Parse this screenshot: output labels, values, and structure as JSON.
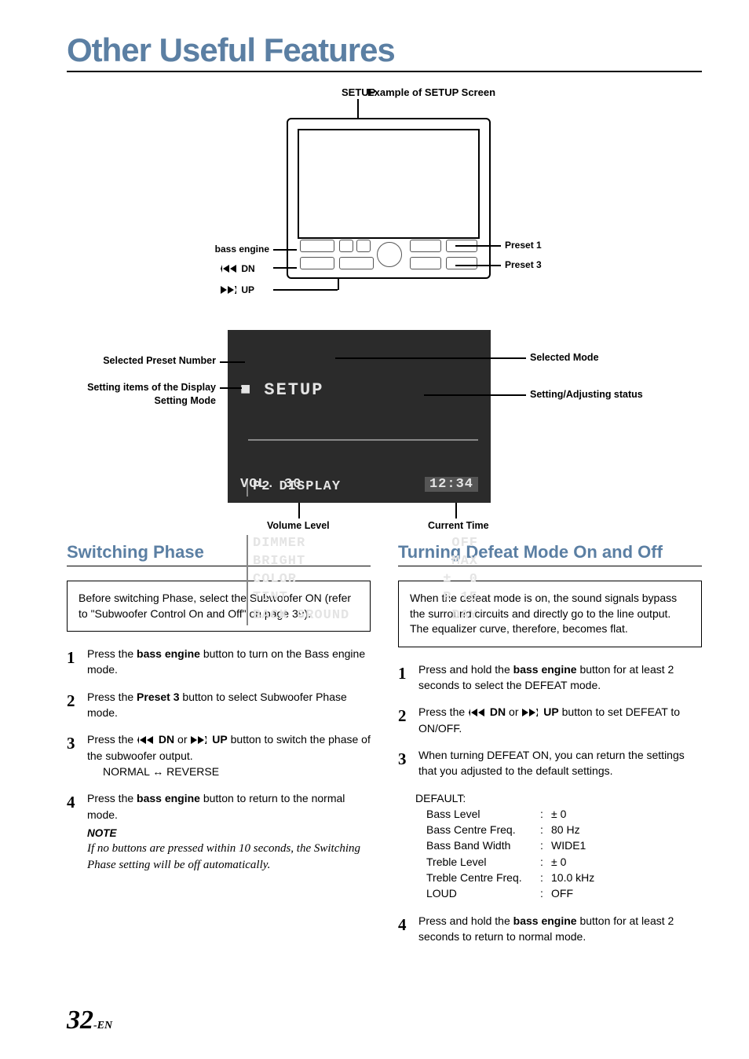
{
  "page_title": "Other Useful Features",
  "front_panel": {
    "setup_label": "SETUP",
    "bass_engine": "bass engine",
    "dn": "DN",
    "up": "UP",
    "preset1": "Preset 1",
    "preset3": "Preset 3",
    "caption": "Example of SETUP Screen"
  },
  "setup_screen": {
    "title": "SETUP",
    "mode_line": "P2 DISPLAY",
    "items": [
      {
        "name": "DIMMER",
        "value": "OFF"
      },
      {
        "name": "BRIGHT",
        "value": "MAX"
      },
      {
        "name": "COLOR",
        "value": "±  0"
      },
      {
        "name": "TINT",
        "value": "R 15"
      },
      {
        "name": "BACK GROUND",
        "value": "DAY"
      }
    ],
    "volume": "VOL. 30",
    "time": "12:34",
    "labels": {
      "selected_preset": "Selected Preset Number",
      "setting_items": "Setting items of the Display Setting Mode",
      "selected_mode": "Selected Mode",
      "setting_status": "Setting/Adjusting status",
      "volume_level": "Volume Level",
      "current_time": "Current Time"
    }
  },
  "left": {
    "heading": "Switching Phase",
    "intro": "Before switching Phase, select the Subwoofer ON (refer to \"Subwoofer Control On and Off\" on page 39).",
    "steps": {
      "s1a": "Press the ",
      "s1b": "bass engine",
      "s1c": " button to turn on the Bass engine mode.",
      "s2a": "Press the ",
      "s2b": "Preset 3",
      "s2c": " button to select Subwoofer Phase mode.",
      "s3a": "Press the ",
      "s3b": " DN",
      "s3c": " or ",
      "s3d": " UP",
      "s3e": " button to switch the phase of the subwoofer output.",
      "s3sub": "NORMAL ↔ REVERSE",
      "s4a": "Press the ",
      "s4b": "bass engine",
      "s4c": " button to return to the normal mode."
    },
    "note_label": "NOTE",
    "note_text": "If no buttons are pressed within 10 seconds, the Switching Phase setting will be off automatically."
  },
  "right": {
    "heading": "Turning Defeat Mode On and Off",
    "intro": "When the defeat mode is on, the sound signals bypass the surround circuits and directly go to the line output. The equalizer curve, therefore, becomes flat.",
    "steps": {
      "s1a": "Press and hold the ",
      "s1b": "bass engine",
      "s1c": " button for at least 2 seconds to select the DEFEAT mode.",
      "s2a": "Press the ",
      "s2b": " DN",
      "s2c": " or ",
      "s2d": " UP",
      "s2e": " button to set DEFEAT to ON/OFF.",
      "s3": "When turning DEFEAT ON, you can return the settings that you adjusted to the default settings.",
      "s4a": "Press and hold the ",
      "s4b": "bass engine",
      "s4c": " button for at least 2 seconds to return to normal mode."
    },
    "defaults_heading": "DEFAULT:",
    "defaults": [
      {
        "name": "Bass Level",
        "value": "± 0"
      },
      {
        "name": "Bass Centre Freq.",
        "value": "80 Hz"
      },
      {
        "name": "Bass Band Width",
        "value": "WIDE1"
      },
      {
        "name": "Treble Level",
        "value": "± 0"
      },
      {
        "name": "Treble Centre Freq.",
        "value": "10.0 kHz"
      },
      {
        "name": "LOUD",
        "value": "OFF"
      }
    ]
  },
  "page_number": {
    "num": "32",
    "suffix": "-EN"
  }
}
